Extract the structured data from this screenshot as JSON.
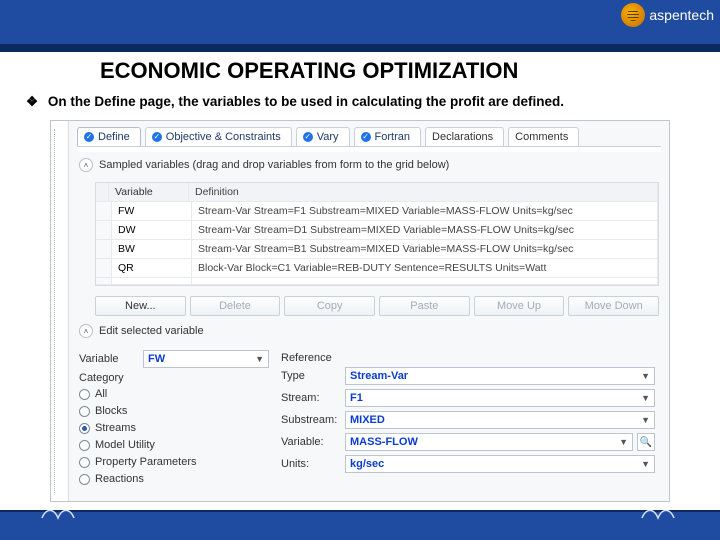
{
  "header": {
    "title": "ECONOMIC OPERATING OPTIMIZATION",
    "brand": "aspentech"
  },
  "subtitle": "On the Define page, the variables to be used in calculating the profit are defined.",
  "tabs": [
    {
      "label": "Define",
      "checked": true,
      "active": true
    },
    {
      "label": "Objective & Constraints",
      "checked": true,
      "active": false
    },
    {
      "label": "Vary",
      "checked": true,
      "active": false
    },
    {
      "label": "Fortran",
      "checked": true,
      "active": false
    },
    {
      "label": "Declarations",
      "checked": false,
      "active": false
    },
    {
      "label": "Comments",
      "checked": false,
      "active": false
    }
  ],
  "sampled_hint": "Sampled variables (drag and drop variables from form to the grid below)",
  "grid": {
    "head_var": "Variable",
    "head_def": "Definition",
    "rows": [
      {
        "var": "FW",
        "def": "Stream-Var Stream=F1 Substream=MIXED Variable=MASS-FLOW Units=kg/sec"
      },
      {
        "var": "DW",
        "def": "Stream-Var Stream=D1 Substream=MIXED Variable=MASS-FLOW Units=kg/sec"
      },
      {
        "var": "BW",
        "def": "Stream-Var Stream=B1 Substream=MIXED Variable=MASS-FLOW Units=kg/sec"
      },
      {
        "var": "QR",
        "def": "Block-Var Block=C1 Variable=REB-DUTY Sentence=RESULTS Units=Watt"
      }
    ]
  },
  "buttons": {
    "new": "New...",
    "delete": "Delete",
    "copy": "Copy",
    "paste": "Paste",
    "move_up": "Move Up",
    "move_down": "Move Down"
  },
  "edit_section": "Edit selected variable",
  "left_panel": {
    "variable_label": "Variable",
    "variable_value": "FW",
    "category_label": "Category",
    "radios": [
      {
        "label": "All",
        "on": false
      },
      {
        "label": "Blocks",
        "on": false
      },
      {
        "label": "Streams",
        "on": true
      },
      {
        "label": "Model Utility",
        "on": false
      },
      {
        "label": "Property Parameters",
        "on": false
      },
      {
        "label": "Reactions",
        "on": false
      }
    ]
  },
  "right_panel": {
    "reference_label": "Reference",
    "fields": [
      {
        "name": "Type",
        "value": "Stream-Var"
      },
      {
        "name": "Stream:",
        "value": "F1"
      },
      {
        "name": "Substream:",
        "value": "MIXED"
      },
      {
        "name": "Variable:",
        "value": "MASS-FLOW",
        "lookup": true
      },
      {
        "name": "Units:",
        "value": "kg/sec"
      }
    ]
  }
}
